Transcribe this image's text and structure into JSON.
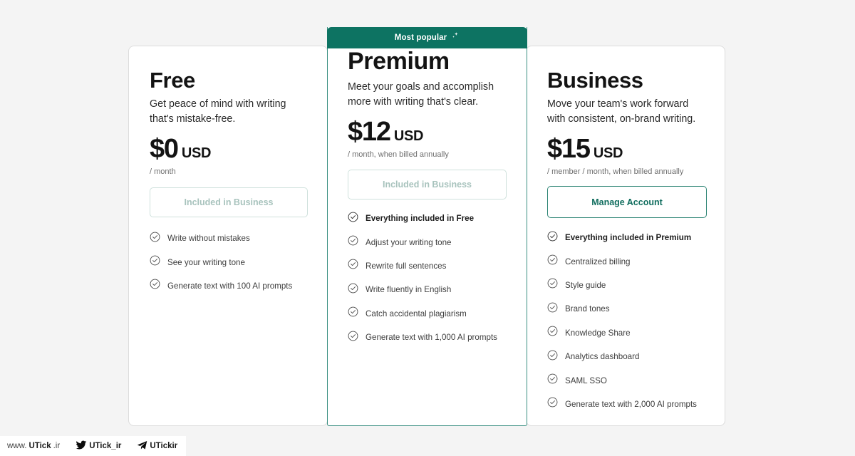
{
  "theme": {
    "page_background": "#f4f4f4",
    "brand_teal": "#0d7362",
    "featured_border": "#3a8f81",
    "card_border": "#dcdcdc",
    "disabled_text": "#a8c3bd"
  },
  "badge": {
    "label": "Most popular",
    "icon": "sparkle-icon"
  },
  "plans": [
    {
      "id": "free",
      "name": "Free",
      "description": "Get peace of mind with writing that's mistake-free.",
      "price_amount": "$0",
      "price_currency": "USD",
      "price_period": "/ month",
      "cta_label": "Included in Business",
      "cta_state": "disabled",
      "features": [
        {
          "label": "Write without mistakes",
          "bold": false,
          "icon": "check-circle-icon"
        },
        {
          "label": "See your writing tone",
          "bold": false,
          "icon": "check-circle-icon"
        },
        {
          "label": "Generate text with 100 AI prompts",
          "bold": false,
          "icon": "check-circle-icon"
        }
      ]
    },
    {
      "id": "premium",
      "name": "Premium",
      "description": "Meet your goals and accomplish more with writing that's clear.",
      "price_amount": "$12",
      "price_currency": "USD",
      "price_period": "/ month, when billed annually",
      "cta_label": "Included in Business",
      "cta_state": "disabled",
      "featured": true,
      "features": [
        {
          "label": "Everything included in Free",
          "bold": true,
          "icon": "check-circle-icon"
        },
        {
          "label": "Adjust your writing tone",
          "bold": false,
          "icon": "check-circle-icon"
        },
        {
          "label": "Rewrite full sentences",
          "bold": false,
          "icon": "check-circle-icon"
        },
        {
          "label": "Write fluently in English",
          "bold": false,
          "icon": "check-circle-icon"
        },
        {
          "label": "Catch accidental plagiarism",
          "bold": false,
          "icon": "check-circle-icon"
        },
        {
          "label": "Generate text with 1,000 AI prompts",
          "bold": false,
          "icon": "check-circle-icon"
        }
      ]
    },
    {
      "id": "business",
      "name": "Business",
      "description": "Move your team's work forward with consistent, on-brand writing.",
      "price_amount": "$15",
      "price_currency": "USD",
      "price_period": "/ member / month, when billed annually",
      "cta_label": "Manage Account",
      "cta_state": "primary",
      "features": [
        {
          "label": "Everything included in Premium",
          "bold": true,
          "icon": "check-circle-icon"
        },
        {
          "label": "Centralized billing",
          "bold": false,
          "icon": "check-circle-icon"
        },
        {
          "label": "Style guide",
          "bold": false,
          "icon": "check-circle-icon"
        },
        {
          "label": "Brand tones",
          "bold": false,
          "icon": "check-circle-icon"
        },
        {
          "label": "Knowledge Share",
          "bold": false,
          "icon": "check-circle-icon"
        },
        {
          "label": "Analytics dashboard",
          "bold": false,
          "icon": "check-circle-icon"
        },
        {
          "label": "SAML SSO",
          "bold": false,
          "icon": "check-circle-icon"
        },
        {
          "label": "Generate text with 2,000 AI prompts",
          "bold": false,
          "icon": "check-circle-icon"
        }
      ]
    }
  ],
  "watermark": {
    "website_prefix": "www.",
    "website_main": "UTick",
    "website_suffix": ".ir",
    "twitter_handle": "UTick_ir",
    "twitter_icon": "twitter-bird-icon",
    "telegram_handle": "UTickir",
    "telegram_icon": "telegram-plane-icon"
  }
}
